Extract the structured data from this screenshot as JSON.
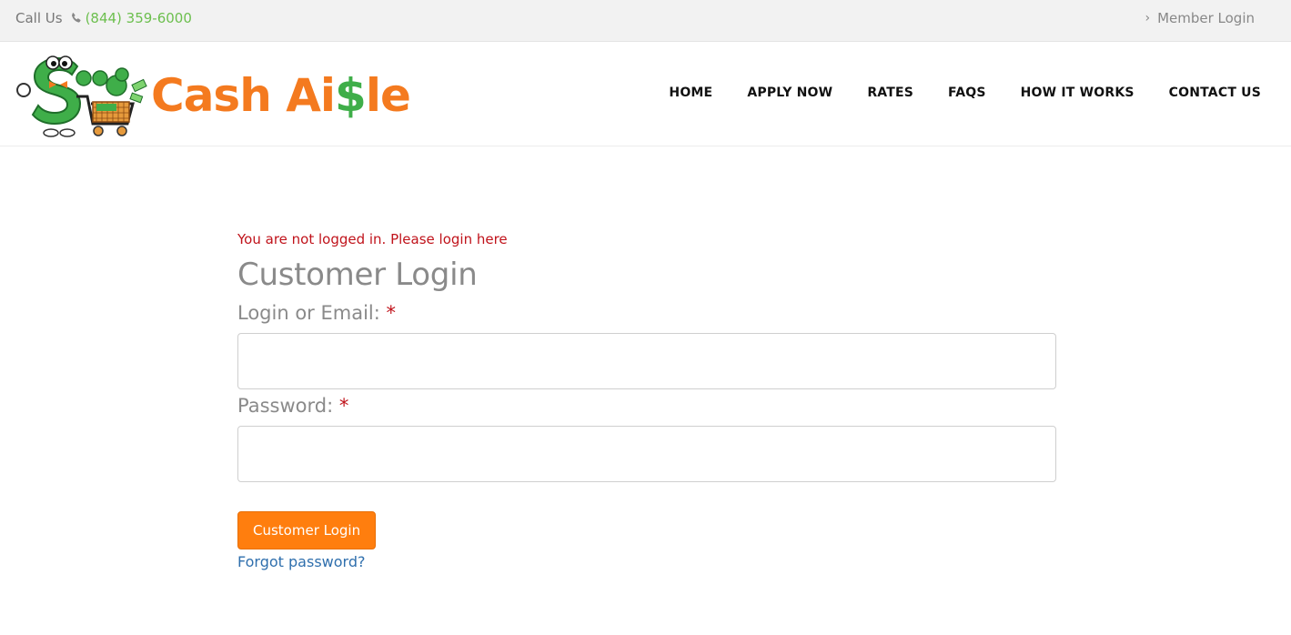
{
  "topbar": {
    "call_label": "Call Us",
    "phone_icon": "phone-icon",
    "phone": "(844) 359-6000",
    "member_login": "Member Login",
    "member_icon": "chevron-right-icon"
  },
  "header": {
    "logo_text_prefix": "Cash Ai",
    "logo_text_dollar": "$",
    "logo_text_suffix": "le",
    "nav": [
      "HOME",
      "APPLY NOW",
      "RATES",
      "FAQS",
      "HOW IT WORKS",
      "CONTACT US"
    ]
  },
  "login": {
    "notice": "You are not logged in. Please login here",
    "title": "Customer Login",
    "email_label": "Login or Email:",
    "password_label": "Password:",
    "required_mark": "*",
    "email_value": "",
    "password_value": "",
    "submit_label": "Customer Login",
    "forgot_label": "Forgot password?"
  },
  "colors": {
    "accent_orange": "#ff7e0e",
    "brand_green": "#3fae49",
    "error_red": "#c0131b",
    "link_blue": "#2f6fad"
  }
}
